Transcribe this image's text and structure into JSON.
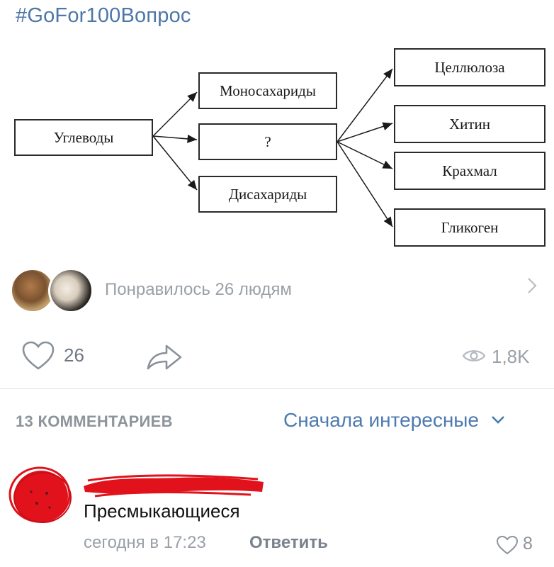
{
  "post": {
    "hashtag": "#GoFor100Вопрос"
  },
  "diagram": {
    "root": "Углеводы",
    "middle": [
      "Моносахариды",
      "?",
      "Дисахариды"
    ],
    "right": [
      "Целлюлоза",
      "Хитин",
      "Крахмал",
      "Гликоген"
    ]
  },
  "likes_bar": {
    "liked_text": "Понравилось 26 людям"
  },
  "actions": {
    "like_count": "26",
    "views_count": "1,8K"
  },
  "comments": {
    "count_label": "13 КОММЕНТАРИЕВ",
    "sort_label": "Сначала интересные",
    "items": [
      {
        "text": "Пресмыкающиеся",
        "time": "сегодня в 17:23",
        "reply_label": "Ответить",
        "likes": "8"
      }
    ]
  }
}
